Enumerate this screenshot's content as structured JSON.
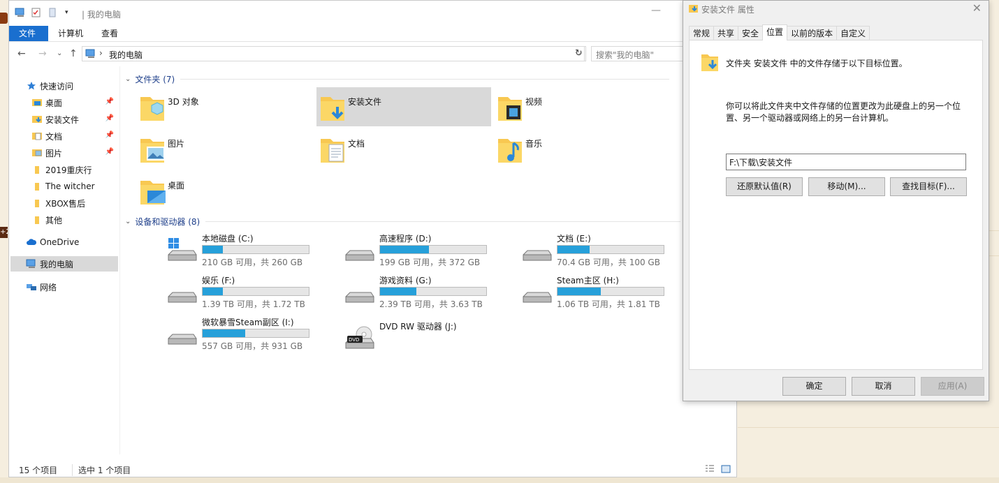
{
  "explorer": {
    "title": "我的电脑",
    "ribbon_tabs": [
      "文件",
      "计算机",
      "查看"
    ],
    "address": {
      "crumb": "我的电脑"
    },
    "search_placeholder": "搜索\"我的电脑\"",
    "sidebar": [
      {
        "label": "快速访问",
        "icon": "star-icon"
      },
      {
        "label": "桌面",
        "icon": "desktop-folder-icon",
        "pinned": true
      },
      {
        "label": "安装文件",
        "icon": "download-folder-icon",
        "pinned": true
      },
      {
        "label": "文档",
        "icon": "document-folder-icon",
        "pinned": true
      },
      {
        "label": "图片",
        "icon": "picture-folder-icon",
        "pinned": true
      },
      {
        "label": "2019重庆行",
        "icon": "folder-icon"
      },
      {
        "label": "The witcher",
        "icon": "folder-icon"
      },
      {
        "label": "XBOX售后",
        "icon": "folder-icon"
      },
      {
        "label": "其他",
        "icon": "folder-icon"
      },
      {
        "label": "OneDrive",
        "icon": "cloud-icon"
      },
      {
        "label": "我的电脑",
        "icon": "pc-icon",
        "selected": true
      },
      {
        "label": "网络",
        "icon": "network-icon"
      }
    ],
    "folders_header": "文件夹 (7)",
    "folders": [
      {
        "label": "3D 对象",
        "icon": "3d-objects-folder-icon"
      },
      {
        "label": "安装文件",
        "icon": "download-folder-icon",
        "selected": true
      },
      {
        "label": "视频",
        "icon": "video-folder-icon"
      },
      {
        "label": "图片",
        "icon": "picture-folder-icon"
      },
      {
        "label": "文档",
        "icon": "document-folder-icon"
      },
      {
        "label": "音乐",
        "icon": "music-folder-icon"
      },
      {
        "label": "桌面",
        "icon": "desktop-folder-icon"
      }
    ],
    "drives_header": "设备和驱动器 (8)",
    "drives": [
      {
        "name": "本地磁盘 (C:)",
        "free": "210 GB 可用，共 260 GB",
        "used_fraction": 0.19,
        "icon": "windows-drive-icon"
      },
      {
        "name": "高速程序 (D:)",
        "free": "199 GB 可用，共 372 GB",
        "used_fraction": 0.46,
        "icon": "drive-icon"
      },
      {
        "name": "文档 (E:)",
        "free": "70.4 GB 可用，共 100 GB",
        "used_fraction": 0.3,
        "icon": "drive-icon"
      },
      {
        "name": "娱乐 (F:)",
        "free": "1.39 TB 可用，共 1.72 TB",
        "used_fraction": 0.19,
        "icon": "drive-icon"
      },
      {
        "name": "游戏资料 (G:)",
        "free": "2.39 TB 可用，共 3.63 TB",
        "used_fraction": 0.34,
        "icon": "drive-icon"
      },
      {
        "name": "Steam主区 (H:)",
        "free": "1.06 TB 可用，共 1.81 TB",
        "used_fraction": 0.41,
        "icon": "drive-icon"
      },
      {
        "name": "微软暴雪Steam副区 (I:)",
        "free": "557 GB 可用，共 931 GB",
        "used_fraction": 0.4,
        "icon": "drive-icon"
      },
      {
        "name": "DVD RW 驱动器 (J:)",
        "icon": "dvd-drive-icon"
      }
    ],
    "status": {
      "items": "15 个项目",
      "selected": "选中 1 个项目"
    }
  },
  "dialog": {
    "title": "安装文件 属性",
    "tabs": [
      "常规",
      "共享",
      "安全",
      "位置",
      "以前的版本",
      "自定义"
    ],
    "active_tab": "位置",
    "intro": "文件夹 安装文件 中的文件存储于以下目标位置。",
    "description": "你可以将此文件夹中文件存储的位置更改为此硬盘上的另一个位置、另一个驱动器或网络上的另一台计算机。",
    "path": "F:\\下载\\安装文件",
    "buttons": {
      "restore": "还原默认值(R)",
      "move": "移动(M)...",
      "find": "查找目标(F)..."
    },
    "footer": {
      "ok": "确定",
      "cancel": "取消",
      "apply": "应用(A)"
    }
  },
  "colors": {
    "accent": "#1a6fcf",
    "drive_bar": "#26a0da",
    "folder": "#f8c851",
    "selection": "#d9d9d9"
  }
}
